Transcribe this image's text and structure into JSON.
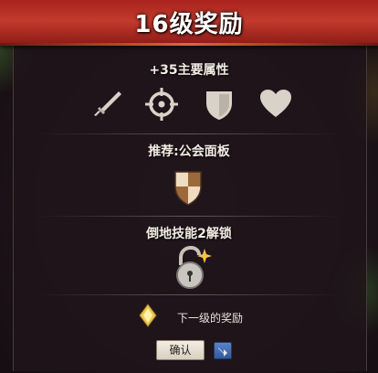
{
  "dialog": {
    "title": "16级奖励",
    "stat_bonus": "+35主要属性",
    "stat_icons": [
      "sword-icon",
      "crosshair-icon",
      "shield-icon",
      "heart-icon"
    ],
    "recommend": "推荐:公会面板",
    "recommend_icon": "guild-shield-icon",
    "unlock": "倒地技能2解锁",
    "unlock_icon": "padlock-icon",
    "next_reward_icon": "diamond-icon",
    "next_reward_label": "下一级的奖励",
    "confirm_label": "确认",
    "share_icon": "share-arrow-icon"
  },
  "colors": {
    "banner": "#c33a2c",
    "panel": "#1e141a",
    "icon": "#d8d2c8",
    "gold": "#e8c850",
    "share_button": "#3f6db5"
  }
}
